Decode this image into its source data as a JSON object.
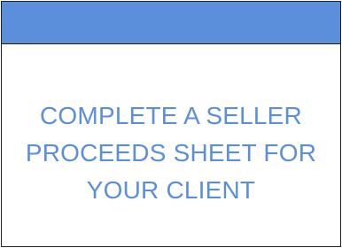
{
  "colors": {
    "header_bar": "#5b8fdc",
    "text": "#5b8fdc",
    "border": "#1f1f1f",
    "background": "#ffffff"
  },
  "card": {
    "lines": [
      "COMPLETE A SELLER",
      "PROCEEDS SHEET FOR",
      "YOUR CLIENT"
    ]
  }
}
